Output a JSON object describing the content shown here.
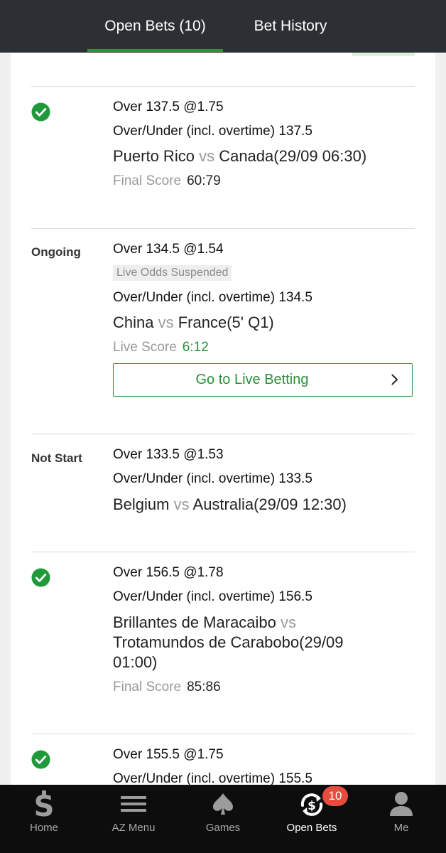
{
  "header": {
    "tabs": [
      {
        "label": "Open Bets (10)",
        "active": true
      },
      {
        "label": "Bet History",
        "active": false
      }
    ]
  },
  "colors": {
    "accent_green": "#1f9a3a",
    "header_bg": "#2c2f33",
    "nav_bg": "#0d0d0d",
    "badge_red": "#e74c3c"
  },
  "bets": [
    {
      "status_icon": "check-circle-icon",
      "title": "Over 137.5 @1.75",
      "market": "Over/Under (incl. overtime) 137.5",
      "team1": "Puerto Rico",
      "vs": "vs",
      "team2": "Canada(29/09 06:30)",
      "score_label": "Final Score",
      "score": "60:79"
    },
    {
      "status": "Ongoing",
      "title": "Over 134.5 @1.54",
      "suspended": "Live Odds Suspended",
      "market": "Over/Under (incl. overtime) 134.5",
      "team1": "China",
      "vs": "vs",
      "team2": "France(5' Q1)",
      "score_label": "Live Score",
      "score": "6:12",
      "button_label": "Go to Live Betting"
    },
    {
      "status": "Not Start",
      "title": "Over 133.5 @1.53",
      "market": "Over/Under (incl. overtime) 133.5",
      "team1": "Belgium",
      "vs": "vs",
      "team2": "Australia(29/09 12:30)"
    },
    {
      "status_icon": "check-circle-icon",
      "title": "Over 156.5 @1.78",
      "market": "Over/Under (incl. overtime) 156.5",
      "team1": "Brillantes de Maracaibo",
      "vs": "vs",
      "team2_line1": "Trotamundos de Carabobo(29/09",
      "team2_line2": "01:00)",
      "score_label": "Final Score",
      "score": "85:86"
    },
    {
      "status_icon": "check-circle-icon",
      "title": "Over 155.5 @1.75",
      "market": "Over/Under (incl. overtime) 155.5"
    }
  ],
  "bottom_nav": {
    "items": [
      {
        "label": "Home",
        "icon": "dollar-s-icon"
      },
      {
        "label": "AZ Menu",
        "icon": "hamburger-menu-icon"
      },
      {
        "label": "Games",
        "icon": "spade-icon"
      },
      {
        "label": "Open Bets",
        "icon": "cycle-dollar-icon",
        "active": true
      },
      {
        "label": "Me",
        "icon": "user-icon"
      }
    ],
    "open_bets_badge": "10"
  }
}
